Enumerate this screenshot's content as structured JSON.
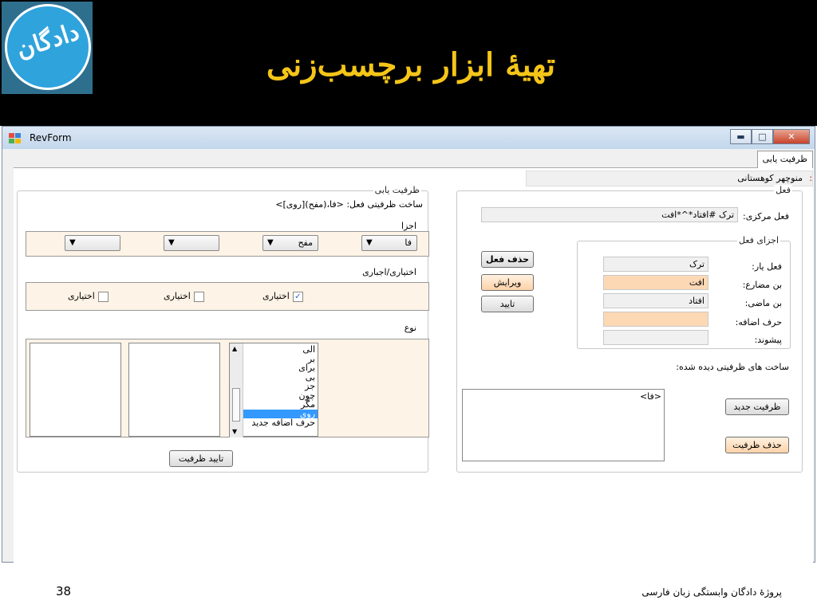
{
  "slide": {
    "logo_text": "دادگان",
    "title": "تهیۀ ابزار برچسب‌زنی",
    "page_number": "38",
    "footer": "پروژۀ دادگان وابستگی زبان فارسی"
  },
  "window": {
    "title": "RevForm",
    "tab_label": "ظرفیت یابی",
    "user_name": "منوچهر کوهستانی",
    "user_colon": ":"
  },
  "verb_group": {
    "caption": "فعل",
    "central_label": "فعل مرکزی:",
    "central_value": "ترک #افتاد*^*افت",
    "delete_verb": "حذف فعل",
    "edit": "ویرایش",
    "confirm": "تایید",
    "parts_caption": "اجزای فعل",
    "light_verb_label": "فعل یار:",
    "light_verb_value": "ترک",
    "present_stem_label": "بن مضارع:",
    "present_stem_value": "افت",
    "past_stem_label": "بن ماضی:",
    "past_stem_value": "افتاد",
    "preposition_label": "حرف اضافه:",
    "preposition_value": "",
    "prefix_label": "پیشوند:",
    "prefix_value": "",
    "seen_structures_label": "ساخت های ظرفیتی دیده شده:",
    "structures_list": [
      "<فا>"
    ],
    "new_valency": "ظرفیت جدید",
    "delete_valency": "حذف ظرفیت"
  },
  "valency_group": {
    "caption": "ظرفیت یابی",
    "structure_label": "ساخت ظرفیتی فعل:",
    "structure_value": "<فا،(مفح)[روی]>",
    "parts_label": "اجزا",
    "combos": [
      "فا",
      "مفح",
      "",
      ""
    ],
    "optional_label": "اختیاری/اجباری",
    "checkboxes": [
      {
        "label": "اختیاری",
        "checked": true
      },
      {
        "label": "اختیاری",
        "checked": false
      },
      {
        "label": "اختیاری",
        "checked": false
      }
    ],
    "type_label": "نوع",
    "prepositions": [
      "الی",
      "بر",
      "برای",
      "بی",
      "جز",
      "چون",
      "مگر",
      "روی",
      "حرف اضافه جدید"
    ],
    "selected_preposition": "روی",
    "confirm_valency": "تایید ظرفیت"
  }
}
